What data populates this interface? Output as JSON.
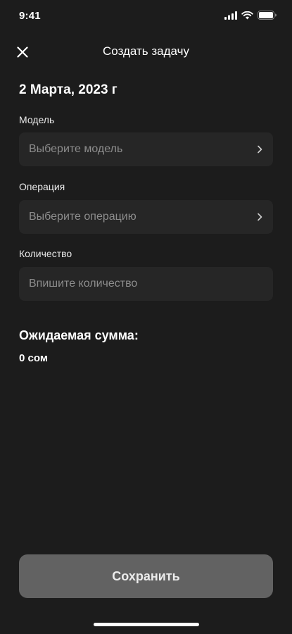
{
  "status_bar": {
    "time": "9:41"
  },
  "nav": {
    "title": "Создать задачу"
  },
  "date": "2 Марта, 2023 г",
  "fields": {
    "model": {
      "label": "Модель",
      "placeholder": "Выберите модель"
    },
    "operation": {
      "label": "Операция",
      "placeholder": "Выберите операцию"
    },
    "quantity": {
      "label": "Количество",
      "placeholder": "Впишите количество"
    }
  },
  "summary": {
    "title": "Ожидаемая сумма:",
    "value": "0 сом"
  },
  "save_label": "Сохранить",
  "icons": {
    "close": "close-icon",
    "chevron": "chevron-right-icon",
    "signal": "signal-icon",
    "wifi": "wifi-icon",
    "battery": "battery-icon"
  },
  "colors": {
    "background": "#1c1c1c",
    "field_bg": "#262626",
    "placeholder": "#8d8d8d",
    "button_bg": "#626262"
  }
}
